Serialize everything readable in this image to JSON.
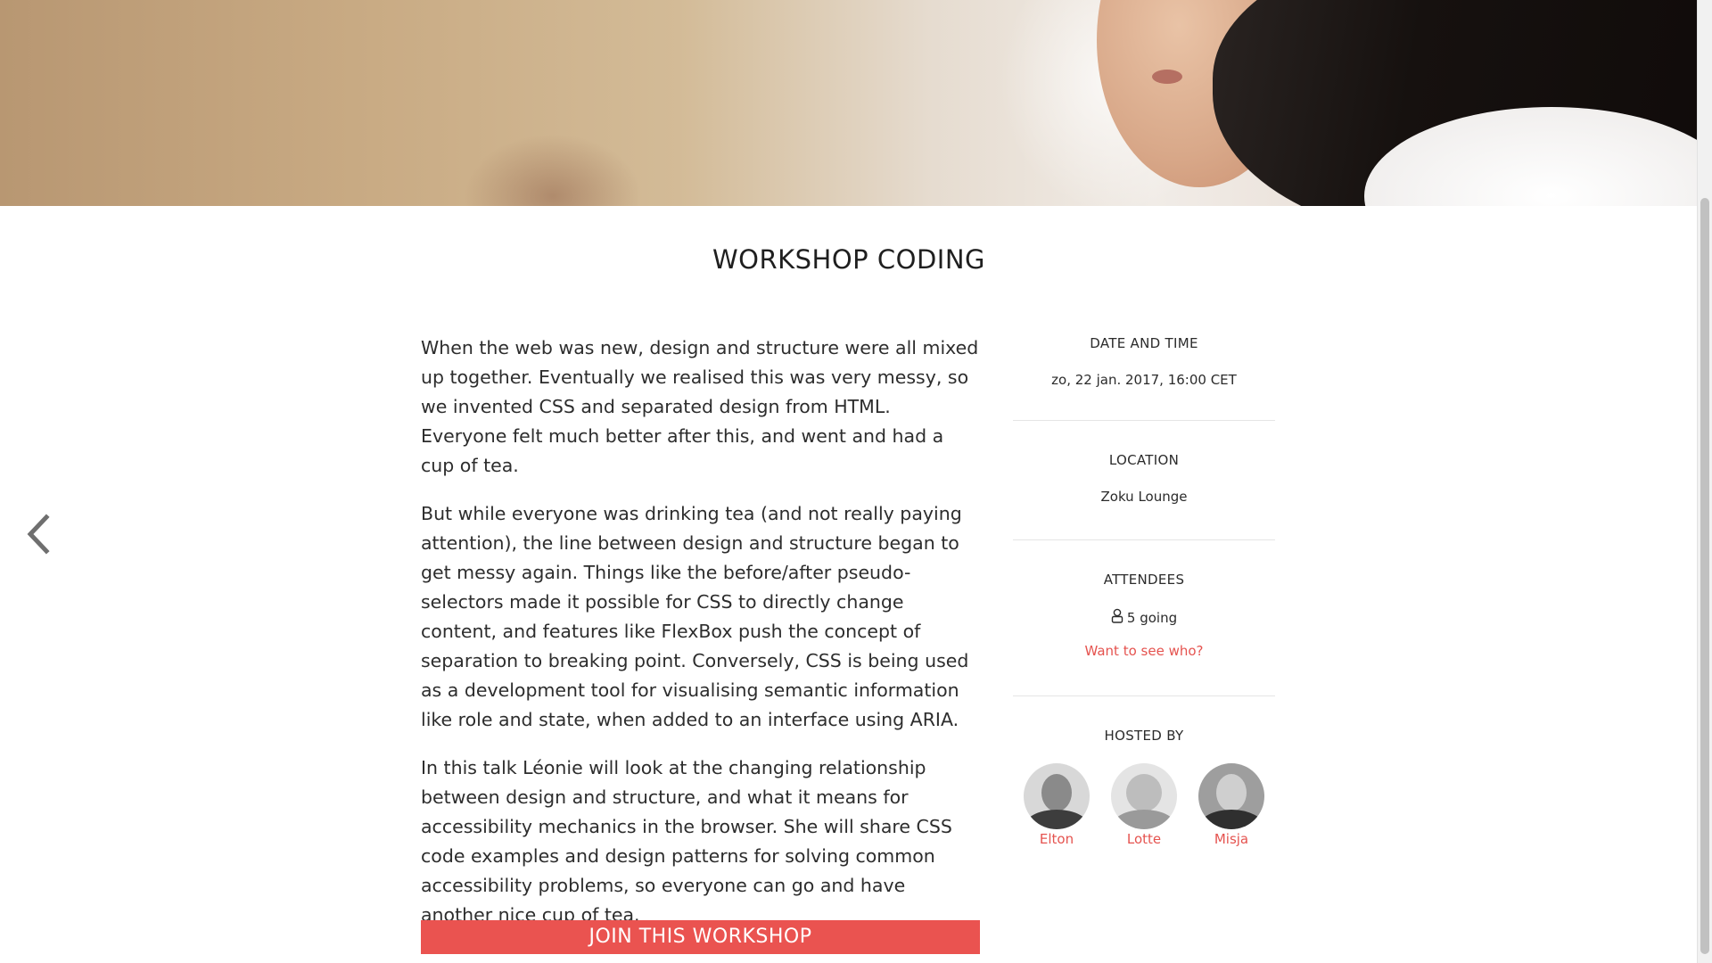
{
  "workshop": {
    "title": "WORKSHOP CODING",
    "description": [
      "When the web was new, design and structure were all mixed up together. Eventually we realised this was very messy, so we invented CSS and separated design from HTML. Everyone felt much better after this, and went and had a cup of tea.",
      "But while everyone was drinking tea (and not really paying attention), the line between design and structure began to get messy again. Things like the before/after pseudo-selectors made it possible for CSS to directly change content, and features like FlexBox push the concept of separation to breaking point. Conversely, CSS is being used as a development tool for visualising semantic information like role and state, when added to an interface using ARIA.",
      "In this talk Léonie will look at the changing relationship between design and structure, and what it means for accessibility mechanics in the browser. She will share CSS code examples and design patterns for solving common accessibility problems, so everyone can go and have another nice cup of tea."
    ],
    "join_label": "JOIN THIS WORKSHOP"
  },
  "details": {
    "date_label": "DATE AND TIME",
    "date_value": "zo, 22 jan. 2017, 16:00 CET",
    "location_label": "LOCATION",
    "location_value": "Zoku Lounge",
    "attendees_label": "ATTENDEES",
    "attendees_going": "5 going",
    "see_who_label": "Want to see who?",
    "hosted_label": "HOSTED BY",
    "hosts": [
      {
        "name": "Elton"
      },
      {
        "name": "Lotte"
      },
      {
        "name": "Misja"
      }
    ]
  },
  "icons": {
    "prev": "chevron-left-icon",
    "attendee": "user-icon"
  },
  "colors": {
    "accent": "#ea5350",
    "link": "#e5534f",
    "text": "#2b2b2b",
    "divider": "#e5e5e5"
  }
}
